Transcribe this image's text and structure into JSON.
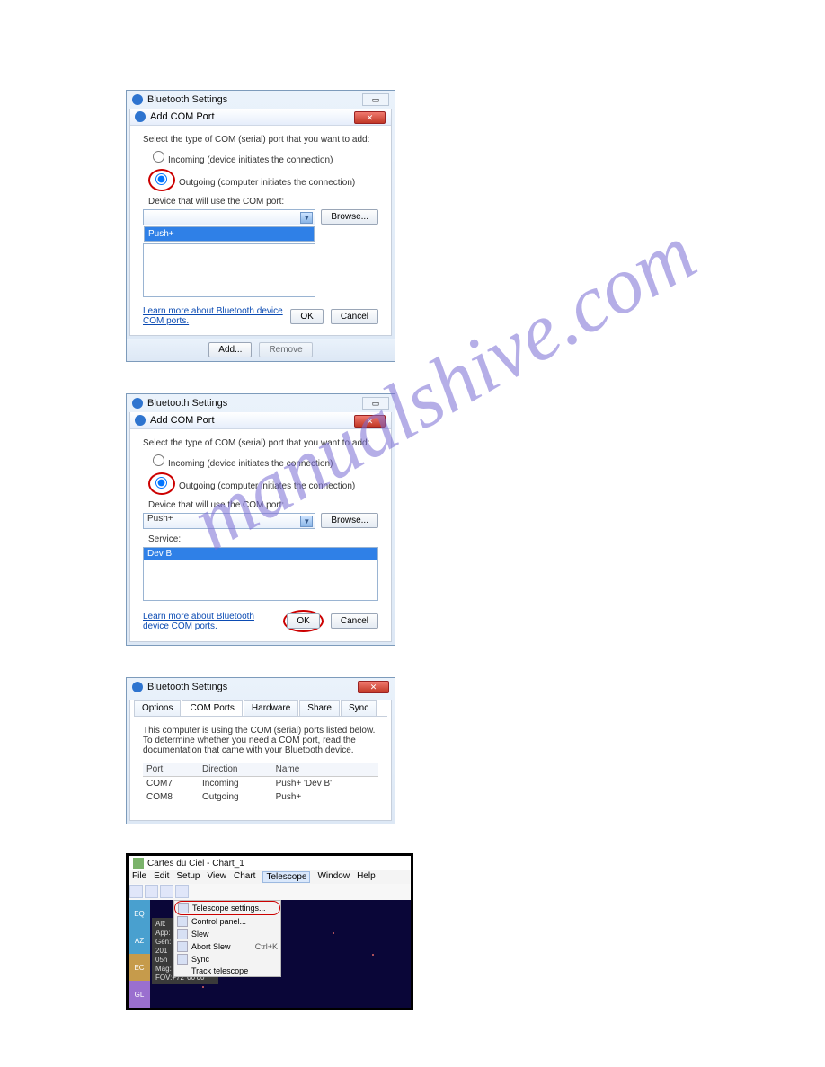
{
  "watermark": "manualshive.com",
  "d1": {
    "outer_title": "Bluetooth Settings",
    "inner_title": "Add COM Port",
    "intro": "Select the type of COM (serial) port that you want to add:",
    "r1": "Incoming (device initiates the connection)",
    "r2": "Outgoing (computer initiates the connection)",
    "device_lbl": "Device that will use the COM port:",
    "drop_item": "Push+",
    "browse": "Browse...",
    "link": "Learn more about Bluetooth device COM ports.",
    "ok": "OK",
    "cancel": "Cancel",
    "add": "Add...",
    "remove": "Remove"
  },
  "d2": {
    "outer_title": "Bluetooth Settings",
    "inner_title": "Add COM Port",
    "intro": "Select the type of COM (serial) port that you want to add:",
    "r1": "Incoming (device initiates the connection)",
    "r2": "Outgoing (computer initiates the connection)",
    "device_lbl": "Device that will use the COM port:",
    "combo_value": "Push+",
    "service_lbl": "Service:",
    "service_val": "Dev B",
    "browse": "Browse...",
    "link": "Learn more about Bluetooth device COM ports.",
    "ok": "OK",
    "cancel": "Cancel"
  },
  "d3": {
    "title": "Bluetooth Settings",
    "tabs": [
      "Options",
      "COM Ports",
      "Hardware",
      "Share",
      "Sync"
    ],
    "blurb": "This computer is using the COM (serial) ports listed below. To determine whether you need a COM port, read the documentation that came with your Bluetooth device.",
    "cols": [
      "Port",
      "Direction",
      "Name"
    ],
    "rows": [
      [
        "COM7",
        "Incoming",
        "Push+ 'Dev B'"
      ],
      [
        "COM8",
        "Outgoing",
        "Push+"
      ]
    ]
  },
  "app": {
    "title": "Cartes du Ciel - Chart_1",
    "menu": [
      "File",
      "Edit",
      "Setup",
      "View",
      "Chart",
      "Telescope",
      "Window",
      "Help"
    ],
    "ctx": [
      {
        "label": "Telescope settings...",
        "hl": true
      },
      {
        "label": "Control panel..."
      },
      {
        "label": "Slew"
      },
      {
        "label": "Abort Slew",
        "hot": "Ctrl+K"
      },
      {
        "label": "Sync"
      },
      {
        "label": "Track telescope"
      }
    ],
    "overlay": [
      "Alt:",
      "App:",
      "Gen:",
      "201",
      "05h",
      "Mag:7.0/10.0.10.0'",
      "FOV:+72°00'00\""
    ],
    "side": [
      {
        "t": "EQ",
        "c": "#49a0cf"
      },
      {
        "t": "AZ",
        "c": "#49a0cf"
      },
      {
        "t": "EC",
        "c": "#c69b4b"
      },
      {
        "t": "GL",
        "c": "#9a6fcf"
      }
    ]
  }
}
